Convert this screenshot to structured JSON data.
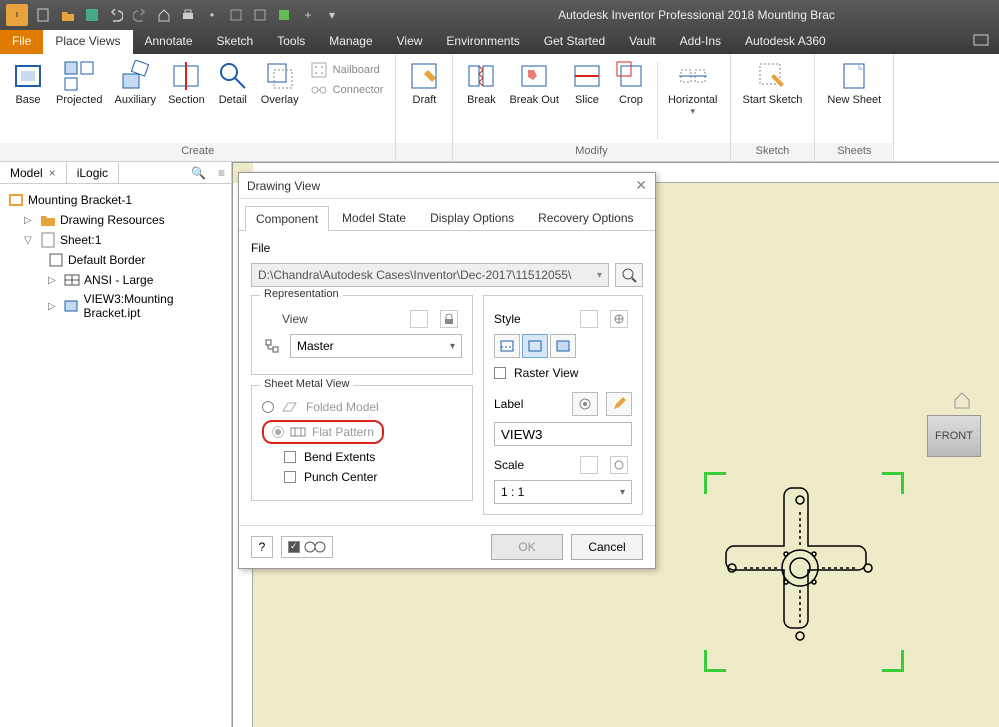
{
  "app": {
    "title": "Autodesk Inventor Professional 2018    Mounting Brac"
  },
  "menutabs": {
    "file": "File",
    "items": [
      "Place Views",
      "Annotate",
      "Sketch",
      "Tools",
      "Manage",
      "View",
      "Environments",
      "Get Started",
      "Vault",
      "Add-Ins",
      "Autodesk A360"
    ],
    "active": "Place Views"
  },
  "ribbon": {
    "create": {
      "label": "Create",
      "buttons": [
        "Base",
        "Projected",
        "Auxiliary",
        "Section",
        "Detail",
        "Overlay"
      ],
      "side": {
        "nailboard": "Nailboard",
        "connector": "Connector"
      }
    },
    "place": {
      "buttons": [
        "Draft"
      ]
    },
    "modify": {
      "label": "Modify",
      "buttons": [
        "Break",
        "Break Out",
        "Slice",
        "Crop",
        "Horizontal"
      ]
    },
    "sketch": {
      "label": "Sketch",
      "buttons": [
        "Start Sketch"
      ]
    },
    "sheets": {
      "label": "Sheets",
      "buttons": [
        "New Sheet"
      ]
    }
  },
  "browser": {
    "tabs": [
      "Model",
      "iLogic"
    ],
    "root": "Mounting Bracket-1",
    "nodes": {
      "res": "Drawing Resources",
      "sheet": "Sheet:1",
      "border": "Default Border",
      "ansi": "ANSI - Large",
      "view3": "VIEW3:Mounting Bracket.ipt"
    }
  },
  "viewcube": {
    "face": "FRONT"
  },
  "dialog": {
    "title": "Drawing View",
    "tabs": [
      "Component",
      "Model State",
      "Display Options",
      "Recovery Options"
    ],
    "active_tab": "Component",
    "file_label": "File",
    "file_path": "D:\\Chandra\\Autodesk Cases\\Inventor\\Dec-2017\\11512055\\",
    "rep": {
      "legend": "Representation",
      "view": "View",
      "master": "Master"
    },
    "smv": {
      "legend": "Sheet Metal View",
      "folded": "Folded Model",
      "flat": "Flat Pattern",
      "bend": "Bend Extents",
      "punch": "Punch Center"
    },
    "style": {
      "legend": "Style",
      "raster": "Raster View",
      "label_lbl": "Label",
      "label_val": "VIEW3",
      "scale_lbl": "Scale",
      "scale_val": "1 : 1"
    },
    "footer": {
      "ok": "OK",
      "cancel": "Cancel"
    }
  }
}
